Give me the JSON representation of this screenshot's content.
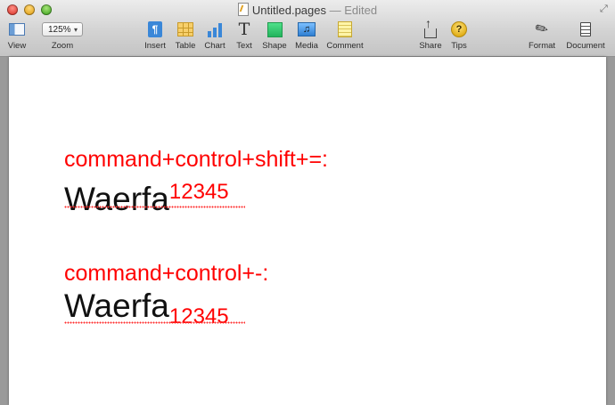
{
  "window": {
    "doc_name": "Untitled.pages",
    "separator": " — ",
    "status": "Edited"
  },
  "toolbar": {
    "view": {
      "label": "View",
      "icon": "sidebar-view-icon"
    },
    "zoom": {
      "label": "Zoom",
      "value": "125%"
    },
    "insert": {
      "label": "Insert",
      "icon": "paragraph-icon"
    },
    "table": {
      "label": "Table",
      "icon": "table-icon"
    },
    "chart": {
      "label": "Chart",
      "icon": "bar-chart-icon"
    },
    "text": {
      "label": "Text",
      "icon": "text-icon"
    },
    "shape": {
      "label": "Shape",
      "icon": "shape-square-icon"
    },
    "media": {
      "label": "Media",
      "icon": "music-note-icon"
    },
    "comment": {
      "label": "Comment",
      "icon": "note-icon"
    },
    "share": {
      "label": "Share",
      "icon": "share-icon"
    },
    "tips": {
      "label": "Tips",
      "icon": "question-icon"
    },
    "format": {
      "label": "Format",
      "icon": "paintbrush-icon"
    },
    "document": {
      "label": "Document",
      "icon": "document-icon"
    }
  },
  "document": {
    "block1": {
      "command": "command+control+shift+=:",
      "word": "Waerfa",
      "digits": "12345",
      "mode": "superscript"
    },
    "block2": {
      "command": "command+control+-:",
      "word": "Waerfa",
      "digits": "12345",
      "mode": "subscript"
    }
  },
  "colors": {
    "command_text": "#ff0000",
    "body_text": "#111111",
    "page": "#ffffff",
    "canvas": "#9a9a9a",
    "accent": "#3a87d8"
  }
}
